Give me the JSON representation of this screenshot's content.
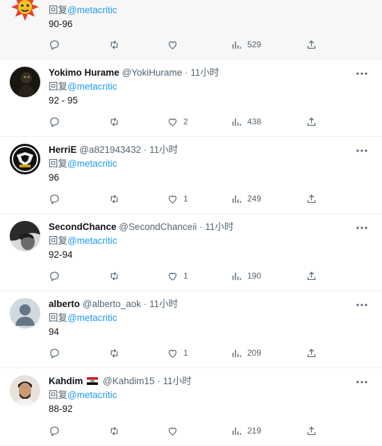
{
  "replies": [
    {
      "name": "",
      "handle": "",
      "time": "",
      "reply_prefix": "回复",
      "mention": "@metacritic",
      "text": "90-96",
      "likes": "",
      "views": "529",
      "avatar": "sunburst-badge-avatar"
    },
    {
      "name": "Yokimo Hurame",
      "handle": "@YokiHurame",
      "dot": "·",
      "time": "11小时",
      "reply_prefix": "回复",
      "mention": "@metacritic",
      "text": "92 - 95",
      "likes": "2",
      "views": "438",
      "avatar": "dark-figure-avatar"
    },
    {
      "name": "HerriE",
      "handle": "@a821943432",
      "dot": "·",
      "time": "11小时",
      "reply_prefix": "回复",
      "mention": "@metacritic",
      "text": "96",
      "likes": "1",
      "views": "249",
      "avatar": "team-logo-avatar"
    },
    {
      "name": "SecondChance",
      "handle": "@SecondChanceii",
      "dot": "·",
      "time": "11小时",
      "reply_prefix": "回复",
      "mention": "@metacritic",
      "text": "92-94",
      "likes": "1",
      "views": "190",
      "avatar": "dark-portrait-avatar"
    },
    {
      "name": "alberto",
      "handle": "@alberto_aok",
      "dot": "·",
      "time": "11小时",
      "reply_prefix": "回复",
      "mention": "@metacritic",
      "text": "94",
      "likes": "1",
      "views": "209",
      "avatar": "default-user-avatar"
    },
    {
      "name": "Kahdim",
      "flag": "iraq-flag",
      "handle": "@Kahdim15",
      "dot": "·",
      "time": "11小时",
      "reply_prefix": "回复",
      "mention": "@metacritic",
      "text": "88-92",
      "likes": "",
      "views": "219",
      "avatar": "man-photo-avatar"
    }
  ],
  "icons": {
    "reply": "reply-icon",
    "retweet": "retweet-icon",
    "like": "heart-icon",
    "views": "views-icon",
    "share": "share-icon",
    "more": "more-icon"
  },
  "colors": {
    "link": "#1d9bf0",
    "secondary_text": "#536471",
    "divider": "#eff3f4"
  }
}
